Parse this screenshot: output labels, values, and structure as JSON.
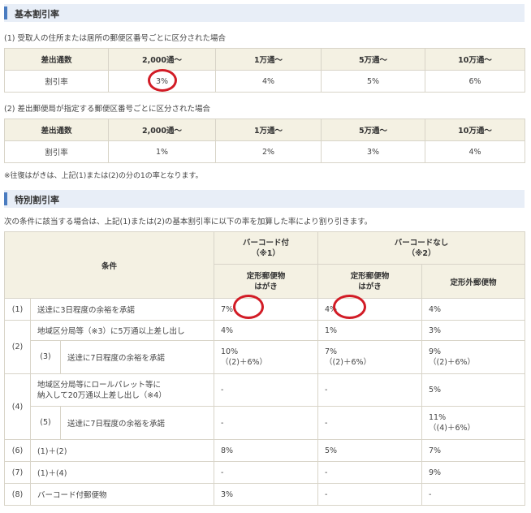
{
  "basic": {
    "title": "基本割引率",
    "case1": "(1) 受取人の住所または居所の郵便区番号ごとに区分された場合",
    "case2": "(2) 差出郵便局が指定する郵便区番号ごとに区分された場合",
    "header": [
      "差出通数",
      "2,000通～",
      "1万通～",
      "5万通～",
      "10万通～"
    ],
    "row1_label": "割引率",
    "row1": [
      "3%",
      "4%",
      "5%",
      "6%"
    ],
    "row2": [
      "1%",
      "2%",
      "3%",
      "4%"
    ],
    "note": "※往復はがきは、上記(1)または(2)の分の1の率となります。"
  },
  "special": {
    "title": "特別割引率",
    "intro": "次の条件に該当する場合は、上記(1)または(2)の基本割引率に以下の率を加算した率により割り引きます。",
    "h_condition": "条件",
    "h_barcode_1": "バーコード付",
    "h_barcode_2": "（※1）",
    "h_nobarcode_1": "バーコードなし",
    "h_nobarcode_2": "（※2）",
    "h_teikei_1": "定形郵便物",
    "h_teikei_2": "はがき",
    "h_teikei_b_1": "定形郵便物",
    "h_teikei_b_2": "はがき",
    "h_teikeigai": "定形外郵便物",
    "rows": {
      "r1_no": "(1)",
      "r1_cond": "送達に3日程度の余裕を承諾",
      "r1_a": "7%",
      "r1_b": "4%",
      "r1_c": "4%",
      "r2_no": "(2)",
      "r2_cond": "地域区分局等（※3）に5万通以上差し出し",
      "r2_a": "4%",
      "r2_b": "1%",
      "r2_c": "3%",
      "r3_no": "(3)",
      "r3_cond": "送達に7日程度の余裕を承諾",
      "r3_a1": "10%",
      "r3_a2": "（(2)＋6%）",
      "r3_b1": "7%",
      "r3_b2": "（(2)＋6%）",
      "r3_c1": "9%",
      "r3_c2": "（(2)＋6%）",
      "r4_no": "(4)",
      "r4_cond1": "地域区分局等にロールパレット等に",
      "r4_cond2": "納入して20万通以上差し出し（※4）",
      "r4_a": "-",
      "r4_b": "-",
      "r4_c": "5%",
      "r5_no": "(5)",
      "r5_cond": "送達に7日程度の余裕を承諾",
      "r5_a": "-",
      "r5_b": "-",
      "r5_c1": "11%",
      "r5_c2": "（(4)＋6%）",
      "r6_no": "(6)",
      "r6_cond": "(1)＋(2)",
      "r6_a": "8%",
      "r6_b": "5%",
      "r6_c": "7%",
      "r7_no": "(7)",
      "r7_cond": "(1)＋(4)",
      "r7_a": "-",
      "r7_b": "-",
      "r7_c": "9%",
      "r8_no": "(8)",
      "r8_cond": "バーコード付郵便物",
      "r8_a": "3%",
      "r8_b": "-",
      "r8_c": "-"
    }
  },
  "colors": {
    "accent": "#4a7cc0",
    "header_bg": "#f4f1e3",
    "highlight": "#d21c26"
  }
}
